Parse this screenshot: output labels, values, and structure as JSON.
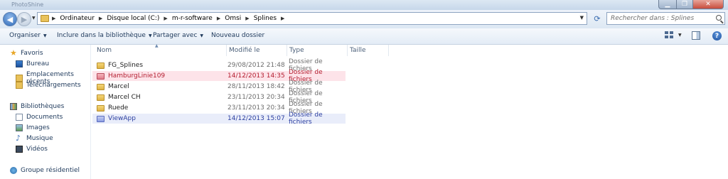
{
  "window": {
    "ghost_title": "PhotoShine"
  },
  "address": {
    "crumbs": [
      "Ordinateur",
      "Disque local (C:)",
      "m-r-software",
      "Omsi",
      "Splines"
    ]
  },
  "search": {
    "placeholder": "Rechercher dans : Splines"
  },
  "toolbar": {
    "organize": "Organiser",
    "include_library": "Inclure dans la bibliothèque",
    "share_with": "Partager avec",
    "new_folder": "Nouveau dossier"
  },
  "sidebar": {
    "favorites": {
      "label": "Favoris",
      "items": [
        "Bureau",
        "Emplacements récents",
        "Téléchargements"
      ]
    },
    "libraries": {
      "label": "Bibliothèques",
      "items": [
        "Documents",
        "Images",
        "Musique",
        "Vidéos"
      ]
    },
    "homegroup": {
      "label": "Groupe résidentiel"
    }
  },
  "columns": {
    "name": "Nom",
    "modified": "Modifié le",
    "type": "Type",
    "size": "Taille"
  },
  "files": [
    {
      "name": "FG_Splines",
      "modified": "29/08/2012 21:48",
      "type": "Dossier de fichiers",
      "state": "normal"
    },
    {
      "name": "HamburgLinie109",
      "modified": "14/12/2013 14:35",
      "type": "Dossier de fichiers",
      "state": "highlight-pink"
    },
    {
      "name": "Marcel",
      "modified": "28/11/2013 18:42",
      "type": "Dossier de fichiers",
      "state": "normal"
    },
    {
      "name": "Marcel CH",
      "modified": "23/11/2013 20:34",
      "type": "Dossier de fichiers",
      "state": "normal"
    },
    {
      "name": "Ruede",
      "modified": "23/11/2013 20:34",
      "type": "Dossier de fichiers",
      "state": "normal"
    },
    {
      "name": "ViewApp",
      "modified": "14/12/2013 15:07",
      "type": "Dossier de fichiers",
      "state": "highlight-blue"
    }
  ],
  "colors": {
    "pink_highlight": "#fde3e9",
    "blue_highlight": "#e9edfa",
    "accent": "#1e395b"
  }
}
